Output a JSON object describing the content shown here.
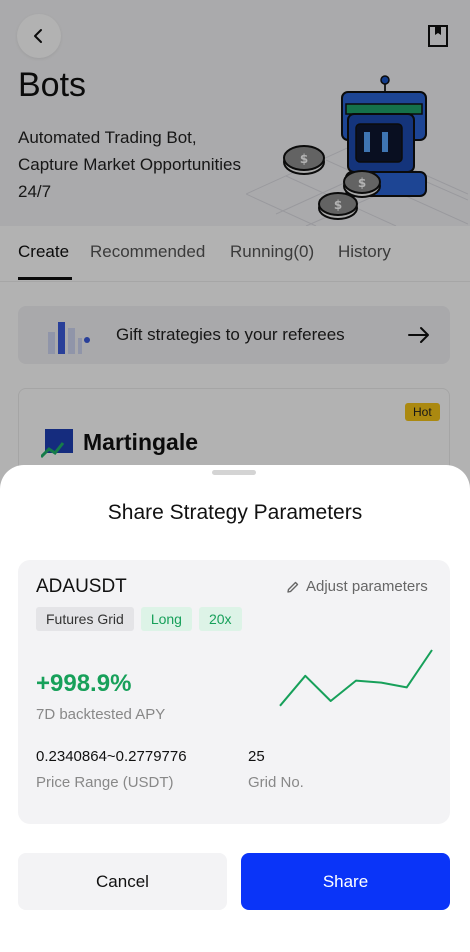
{
  "page": {
    "title": "Bots",
    "subtitle": "Automated Trading Bot, Capture Market Opportunities 24/7",
    "icons": {
      "back": "chevron-left-icon",
      "bookmark": "bookmark-icon",
      "illustration": "robot-coins-illustration"
    }
  },
  "tabs": [
    {
      "label": "Create",
      "active": true
    },
    {
      "label": "Recommended",
      "active": false
    },
    {
      "label": "Running(0)",
      "active": false
    },
    {
      "label": "History",
      "active": false
    }
  ],
  "gift_banner": {
    "text": "Gift strategies to your referees",
    "icon": "bar-chart-icon",
    "arrow": "arrow-right-icon"
  },
  "martingale_card": {
    "badge": "Hot",
    "title": "Martingale"
  },
  "sheet": {
    "title": "Share Strategy Parameters",
    "strategy": {
      "pair": "ADAUSDT",
      "adjust_label": "Adjust parameters",
      "tags": [
        "Futures Grid",
        "Long",
        "20x"
      ],
      "apy_value": "+998.9%",
      "apy_label": "7D backtested APY",
      "price_range_value": "0.2340864~0.2779776",
      "price_range_label": "Price Range (USDT)",
      "grid_value": "25",
      "grid_label": "Grid No.",
      "sparkline": [
        0.18,
        0.62,
        0.25,
        0.55,
        0.52,
        0.45,
        1.0
      ]
    },
    "cancel_label": "Cancel",
    "share_label": "Share"
  },
  "colors": {
    "accent": "#0a34f8",
    "positive": "#17a05a",
    "badge": "#f5c518"
  }
}
